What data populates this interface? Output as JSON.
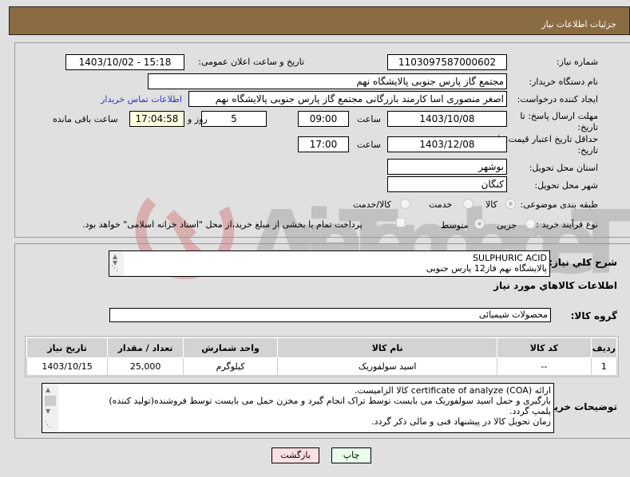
{
  "header": {
    "title": "جزئیات اطلاعات نیاز"
  },
  "form": {
    "need_number": {
      "label": "شماره نیاز:",
      "value": "1103097587000602"
    },
    "announce_datetime": {
      "label": "تاریخ و ساعت اعلان عمومی:",
      "value": "1403/10/02 - 15:18"
    },
    "buyer_org": {
      "label": "نام دستگاه خریدار:",
      "value": "مجتمع گاز پارس جنوبی  پالایشگاه نهم"
    },
    "requester": {
      "label": "ایجاد کننده درخواست:",
      "value": "اصغر منصوری اسا کارمند بازرگانی مجتمع گاز پارس جنوبی  پالایشگاه نهم"
    },
    "buyer_contact_link": "اطلاعات تماس خریدار",
    "response_deadline": {
      "label_line1": "مهلت ارسال پاسخ: تا",
      "label_line2": "تاریخ:",
      "date": "1403/10/08",
      "time_label": "ساعت",
      "time": "09:00",
      "days": "5",
      "days_label": "روز و",
      "remaining": "17:04:58",
      "remaining_label": "ساعت باقی مانده"
    },
    "price_validity": {
      "label_line1": "حداقل تاریخ اعتبار قیمت: تا",
      "label_line2": "تاریخ:",
      "date": "1403/12/08",
      "time_label": "ساعت",
      "time": "17:00"
    },
    "delivery_province": {
      "label": "استان محل تحویل:",
      "value": "بوشهر"
    },
    "delivery_city": {
      "label": "شهر محل تحویل:",
      "value": "کنگان"
    },
    "category": {
      "label": "طبقه بندی موضوعی:",
      "options": [
        "کالا",
        "خدمت",
        "کالا/خدمت"
      ],
      "selected": "کالا"
    },
    "purchase_type": {
      "label": "نوع فرآیند خرید :",
      "options": [
        "جزیی",
        "متوسط"
      ],
      "selected": "متوسط",
      "treasury_checkbox_label": "پرداخت تمام یا بخشی از مبلغ خرید،از محل \"اسناد خزانه اسلامی\" خواهد بود.",
      "treasury_checked": false
    }
  },
  "details": {
    "general_desc_label": "شرح کلي نياز:",
    "general_desc_lines": [
      "SULPHURIC ACID",
      "پالایشگاه نهم فاز12 پارس جنوبی"
    ],
    "goods_info_heading": "اطلاعات کالاهاي مورد نياز",
    "goods_group_label": "گروه کالا:",
    "goods_group_value": "محصولات شیمیائی",
    "table": {
      "headers": [
        "ردیف",
        "کد کالا",
        "نام کالا",
        "واحد شمارش",
        "تعداد / مقدار",
        "تاریخ نیاز"
      ],
      "rows": [
        [
          "1",
          "--",
          "اسید سولفوریک",
          "کیلوگرم",
          "25,000",
          "1403/10/15"
        ]
      ]
    },
    "buyer_notes_label": "توضیحات خریدار:",
    "buyer_notes_lines": [
      "ارائه (COA) certificate of analyze کالا الزامیست.",
      "بارگیری و حمل اسید سولفوریک می بایست توسط تراک انجام گیرد و مخزن حمل می بایست توسط فروشنده(تولید کننده)",
      "پلمپ گردد.",
      "زمان تحویل کالا در پیشنهاد فنی و مالی ذکر گردد."
    ]
  },
  "buttons": {
    "print": "چاپ",
    "back": "بازگشت"
  },
  "watermark": {
    "text": "AriaTender.neT"
  },
  "colors": {
    "header_bg": "#8b6c42",
    "print_bg": "#eaffea",
    "back_bg": "#ffe0e0",
    "remaining_bg": "#ffffe0",
    "link": "#3333cc"
  }
}
